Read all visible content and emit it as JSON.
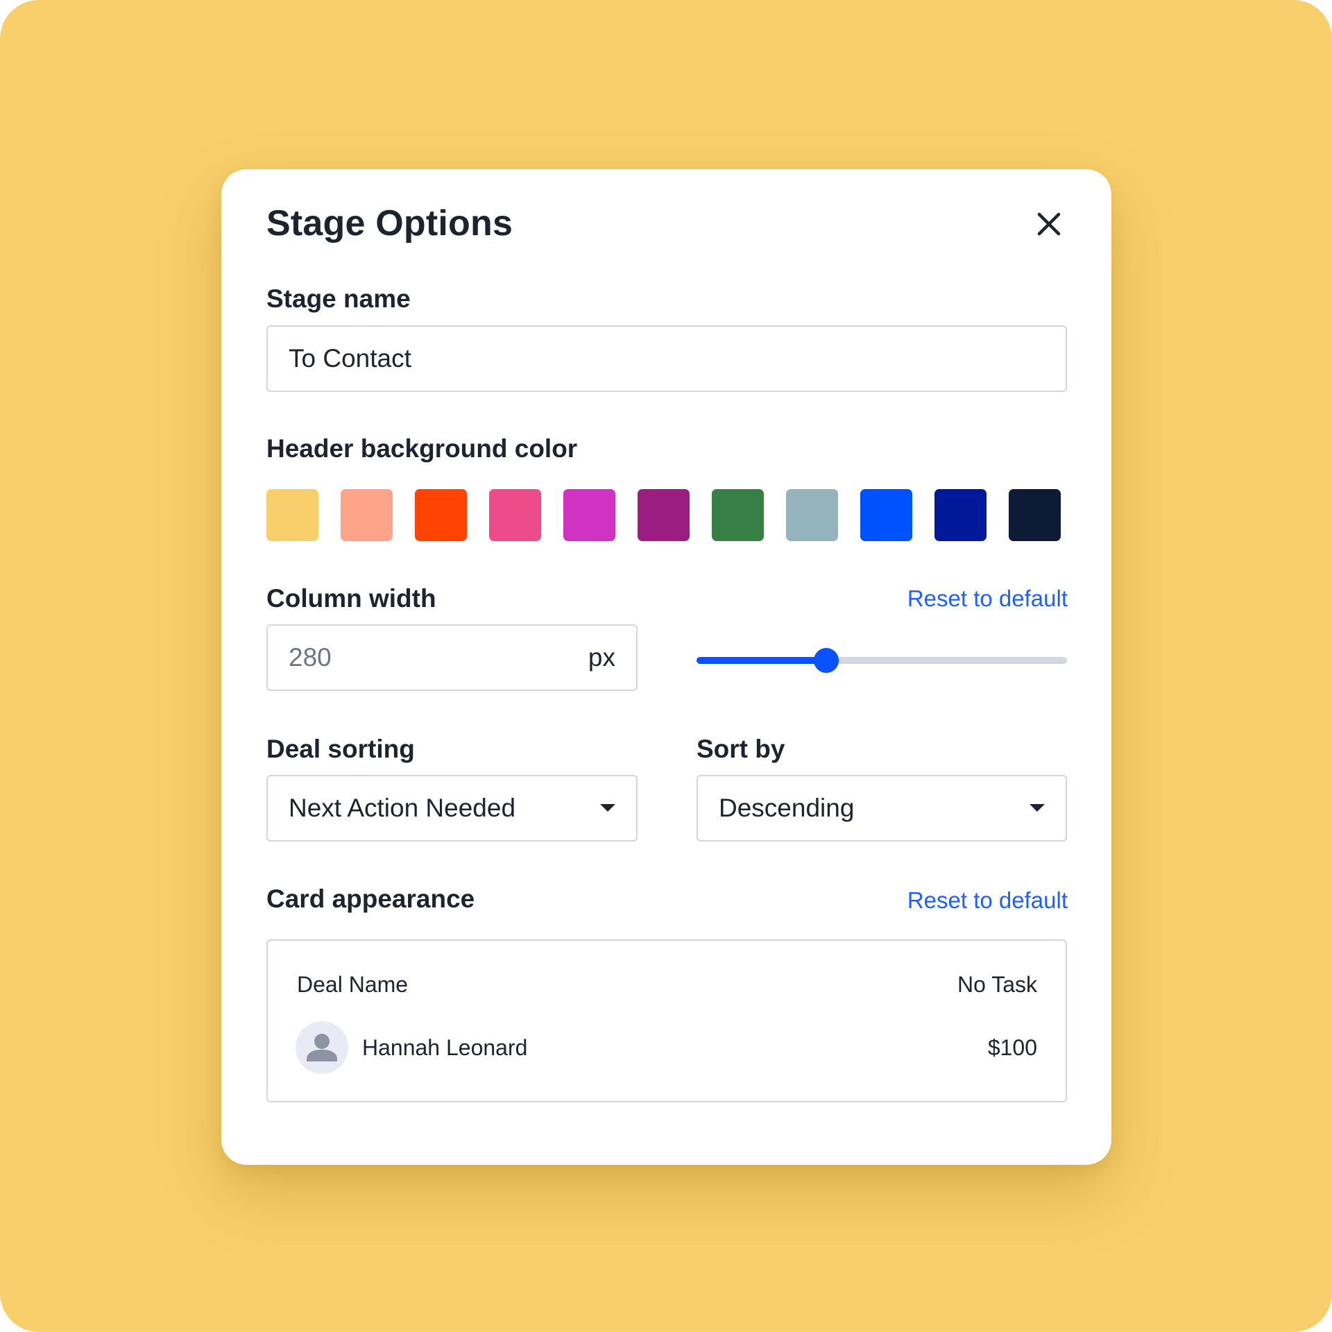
{
  "dialog": {
    "title": "Stage Options"
  },
  "stage_name": {
    "label": "Stage name",
    "value": "To Contact"
  },
  "header_color": {
    "label": "Header background color",
    "swatches": [
      "#f8cf6b",
      "#fea489",
      "#ff4302",
      "#ed4b89",
      "#d032c2",
      "#9b1d82",
      "#367f45",
      "#94b4bd",
      "#0052ff",
      "#00189a",
      "#0e1b36"
    ]
  },
  "column_width": {
    "label": "Column width",
    "reset_label": "Reset to default",
    "value": "280",
    "unit": "px",
    "slider_percent": 35
  },
  "deal_sorting": {
    "label": "Deal sorting",
    "selected": "Next Action Needed"
  },
  "sort_by": {
    "label": "Sort by",
    "selected": "Descending"
  },
  "card_appearance": {
    "label": "Card appearance",
    "reset_label": "Reset to default",
    "preview": {
      "deal_name": "Deal Name",
      "task_status": "No Task",
      "contact_name": "Hannah Leonard",
      "amount": "$100"
    }
  },
  "icons": {
    "close": "close-icon",
    "dropdown": "caret-down-icon",
    "avatar": "user-icon"
  },
  "colors": {
    "accent": "#0a52ff",
    "link": "#1f5eff"
  }
}
